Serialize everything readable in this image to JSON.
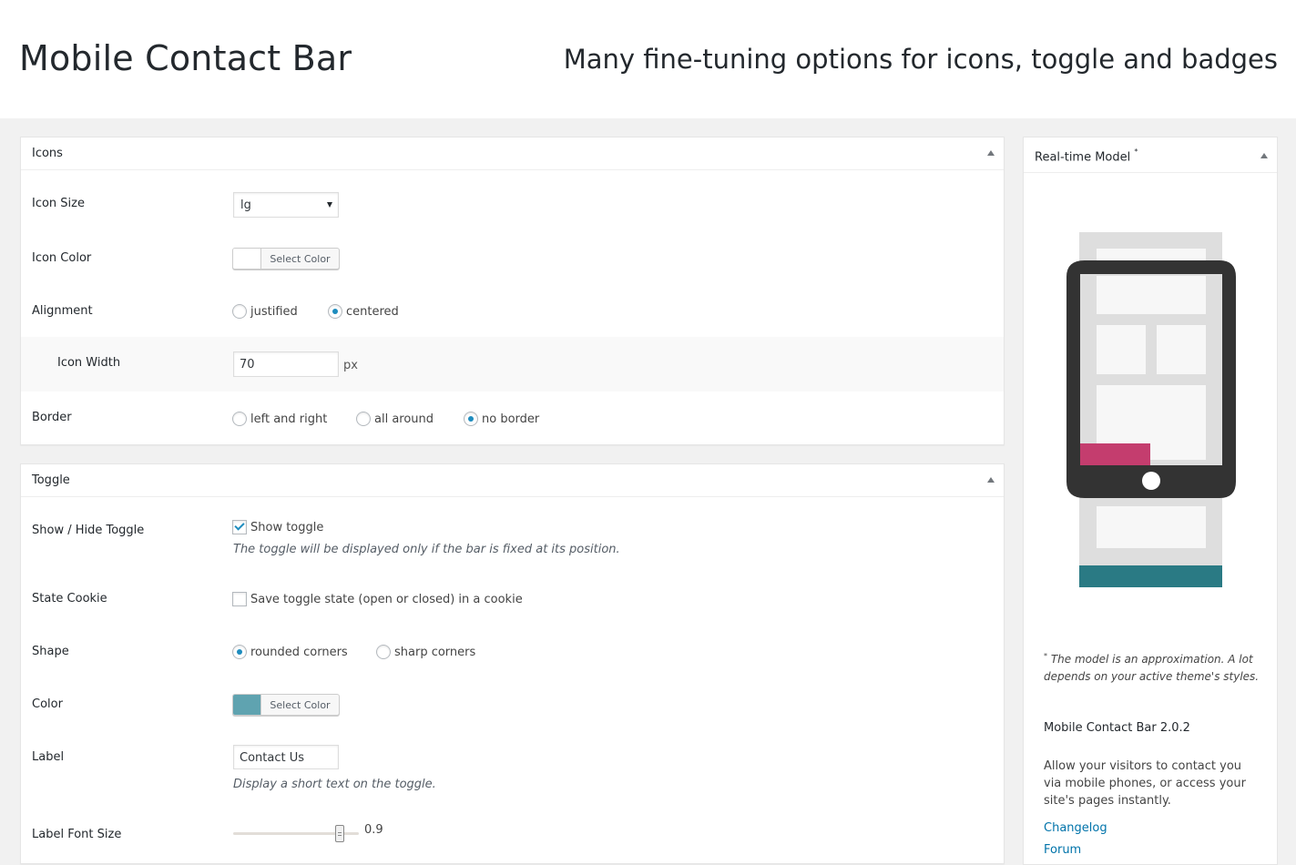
{
  "header": {
    "title": "Mobile Contact Bar",
    "tagline": "Many fine-tuning options for icons, toggle and badges"
  },
  "icons_box": {
    "title": "Icons",
    "icon_size": {
      "label": "Icon Size",
      "value": "lg"
    },
    "icon_color": {
      "label": "Icon Color",
      "button": "Select Color",
      "swatch": "#ffffff"
    },
    "alignment": {
      "label": "Alignment",
      "options": [
        "justified",
        "centered"
      ],
      "selected": "centered"
    },
    "icon_width": {
      "label": "Icon Width",
      "value": "70",
      "unit": "px"
    },
    "border": {
      "label": "Border",
      "options": [
        "left and right",
        "all around",
        "no border"
      ],
      "selected": "no border"
    }
  },
  "toggle_box": {
    "title": "Toggle",
    "show_hide": {
      "label": "Show / Hide Toggle",
      "checkbox_label": "Show toggle",
      "checked": true,
      "description": "The toggle will be displayed only if the bar is fixed at its position."
    },
    "state_cookie": {
      "label": "State Cookie",
      "checkbox_label": "Save toggle state (open or closed) in a cookie",
      "checked": false
    },
    "shape": {
      "label": "Shape",
      "options": [
        "rounded corners",
        "sharp corners"
      ],
      "selected": "rounded corners"
    },
    "color": {
      "label": "Color",
      "button": "Select Color",
      "swatch": "#5fa3b0"
    },
    "label_field": {
      "label": "Label",
      "value": "Contact Us",
      "description": "Display a short text on the toggle."
    },
    "label_font_size": {
      "label": "Label Font Size",
      "value": "0.9",
      "fraction": 0.85
    }
  },
  "sidebar": {
    "title": "Real-time Model",
    "title_mark": "*",
    "note_mark": "*",
    "note": "The model is an approximation. A lot depends on your active theme's styles.",
    "version": "Mobile Contact Bar 2.0.2",
    "about": "Allow your visitors to contact you via mobile phones, or access your site's pages instantly.",
    "links": [
      "Changelog",
      "Forum"
    ]
  },
  "colors": {
    "phone_frame": "#333333",
    "page_blocks": "#f7f7f7",
    "page_bg": "#dedede",
    "toggle_model": "#c43d6e",
    "bar_model": "#2a7a84",
    "link": "#0073aa",
    "radio_dot": "#1e8cbe"
  }
}
